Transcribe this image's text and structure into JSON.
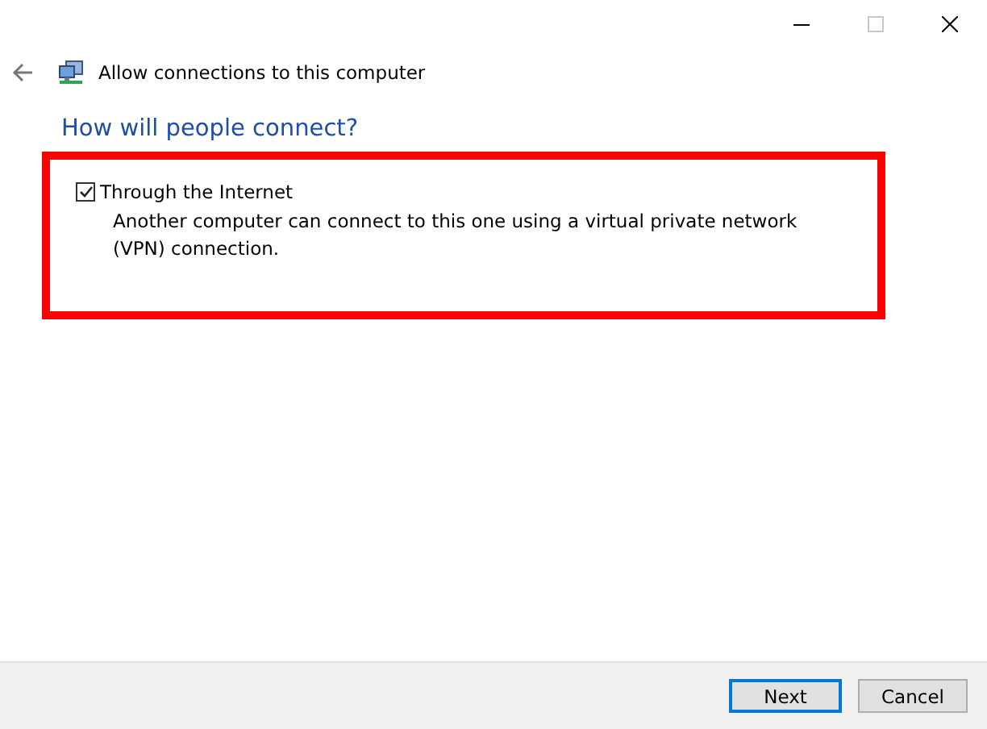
{
  "window": {
    "controls": [
      {
        "kind": "minimize",
        "disabled": false
      },
      {
        "kind": "maximize",
        "disabled": true
      },
      {
        "kind": "close",
        "disabled": false
      }
    ]
  },
  "header": {
    "title": "Allow connections to this computer"
  },
  "heading": "How will people connect?",
  "options": [
    {
      "label": "Through the Internet",
      "checked": true,
      "highlighted": true,
      "description": "Another computer can connect to this one using a virtual private network (VPN) connection."
    }
  ],
  "buttons": [
    {
      "label": "Next",
      "default": true
    },
    {
      "label": "Cancel",
      "default": false
    }
  ]
}
